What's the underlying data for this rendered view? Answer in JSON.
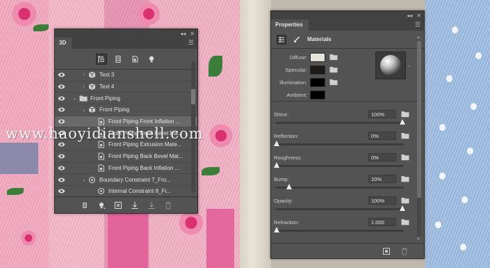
{
  "watermark": "www.haoyidianshell.com",
  "panel3d": {
    "tab": "3D",
    "collapse_glyph": "◂◂",
    "close_glyph": "✕",
    "menu_icon": "panel-menu-icon",
    "toolbar_icons": [
      "scene-icon",
      "mesh-icon",
      "material-icon",
      "light-icon"
    ],
    "rows": [
      {
        "label": "Text 3",
        "indent": 1,
        "arrow": "›",
        "icon": "text-mesh-icon"
      },
      {
        "label": "Text 4",
        "indent": 1,
        "arrow": "›",
        "icon": "text-mesh-icon"
      },
      {
        "label": "Front Piping",
        "indent": 0,
        "arrow": "⌄",
        "icon": "folder-icon"
      },
      {
        "label": "Front Piping",
        "indent": 1,
        "arrow": "⌄",
        "icon": "mesh-icon"
      },
      {
        "label": "Front Piping Front Inflation ...",
        "indent": 2,
        "arrow": "",
        "icon": "material-icon",
        "selected": true
      },
      {
        "label": "Front Piping Front Bevel Ma...",
        "indent": 2,
        "arrow": "",
        "icon": "material-icon"
      },
      {
        "label": "Front Piping Extrusion Mate...",
        "indent": 2,
        "arrow": "",
        "icon": "material-icon"
      },
      {
        "label": "Front Piping Back Bevel Mat...",
        "indent": 2,
        "arrow": "",
        "icon": "material-icon"
      },
      {
        "label": "Front Piping Back Inflation ...",
        "indent": 2,
        "arrow": "",
        "icon": "material-icon"
      },
      {
        "label": "Boundary Constraint 7_Fro...",
        "indent": 1,
        "arrow": "⌄",
        "icon": "constraint-icon"
      },
      {
        "label": "Internal Constraint 8_Fr...",
        "indent": 2,
        "arrow": "",
        "icon": "constraint-icon"
      }
    ],
    "footer_icons": [
      "render-icon",
      "new-light-icon",
      "new-mesh-icon",
      "drop-to-plane-icon",
      "constraint-add-icon",
      "trash-icon"
    ]
  },
  "properties": {
    "tab": "Properties",
    "collapse_glyph": "◂◂",
    "close_glyph": "✕",
    "section": "Materials",
    "colors": [
      {
        "label": "Diffuse:",
        "color": "#e6e2dc"
      },
      {
        "label": "Specular:",
        "color": "#1e1a17"
      },
      {
        "label": "Illumination:",
        "color": "#000000"
      },
      {
        "label": "Ambient:",
        "color": "#000000"
      }
    ],
    "sliders": [
      {
        "label": "Shine:",
        "value": "100%",
        "fraction": 1.0
      },
      {
        "label": "Reflection:",
        "value": "0%",
        "fraction": 0.0
      },
      {
        "label": "Roughness:",
        "value": "0%",
        "fraction": 0.0
      },
      {
        "label": "Bump:",
        "value": "10%",
        "fraction": 0.1
      },
      {
        "label": "Opacity:",
        "value": "100%",
        "fraction": 1.0
      },
      {
        "label": "Refraction:",
        "value": "1.000",
        "fraction": 0.0
      }
    ],
    "footer_icons": [
      "new-material-icon",
      "trash-icon"
    ]
  }
}
